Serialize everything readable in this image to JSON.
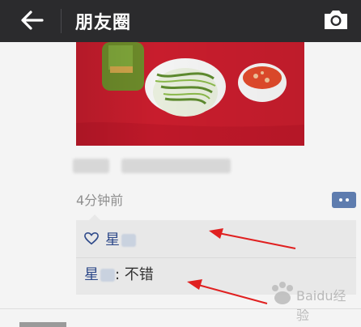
{
  "header": {
    "title": "朋友圈",
    "back_icon": "arrow-left-icon",
    "camera_icon": "camera-icon"
  },
  "post": {
    "timestamp": "4分钟前",
    "likes": {
      "names": [
        "星"
      ]
    },
    "comments": [
      {
        "author": "星",
        "separator": ": ",
        "text": "不错"
      }
    ]
  },
  "watermark": {
    "text": "Baidu经验"
  },
  "colors": {
    "topbar": "#2b2b2d",
    "link": "#2f4a8a",
    "panel": "#e8e8e8",
    "annotation_arrow": "#e02020"
  }
}
